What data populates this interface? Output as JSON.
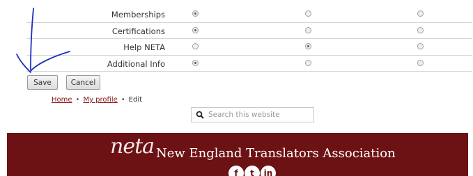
{
  "privacy_rows": [
    {
      "label": "Memberships",
      "selected": 1
    },
    {
      "label": "Certifications",
      "selected": 1
    },
    {
      "label": "Help NETA",
      "selected": 2
    },
    {
      "label": "Additional Info",
      "selected": 1
    }
  ],
  "buttons": {
    "save": "Save",
    "cancel": "Cancel"
  },
  "breadcrumb": {
    "home": "Home",
    "profile": "My profile",
    "current": "Edit",
    "separator": "•"
  },
  "search": {
    "placeholder": "Search this website"
  },
  "footer": {
    "logo": "neta",
    "org_name": "New England Translators Association",
    "social": {
      "facebook": "f",
      "twitter": "t",
      "linkedin": "in"
    }
  },
  "colors": {
    "footer_bg": "#6d1214",
    "link": "#8b1a1a",
    "annotation": "#1f2fbf"
  }
}
